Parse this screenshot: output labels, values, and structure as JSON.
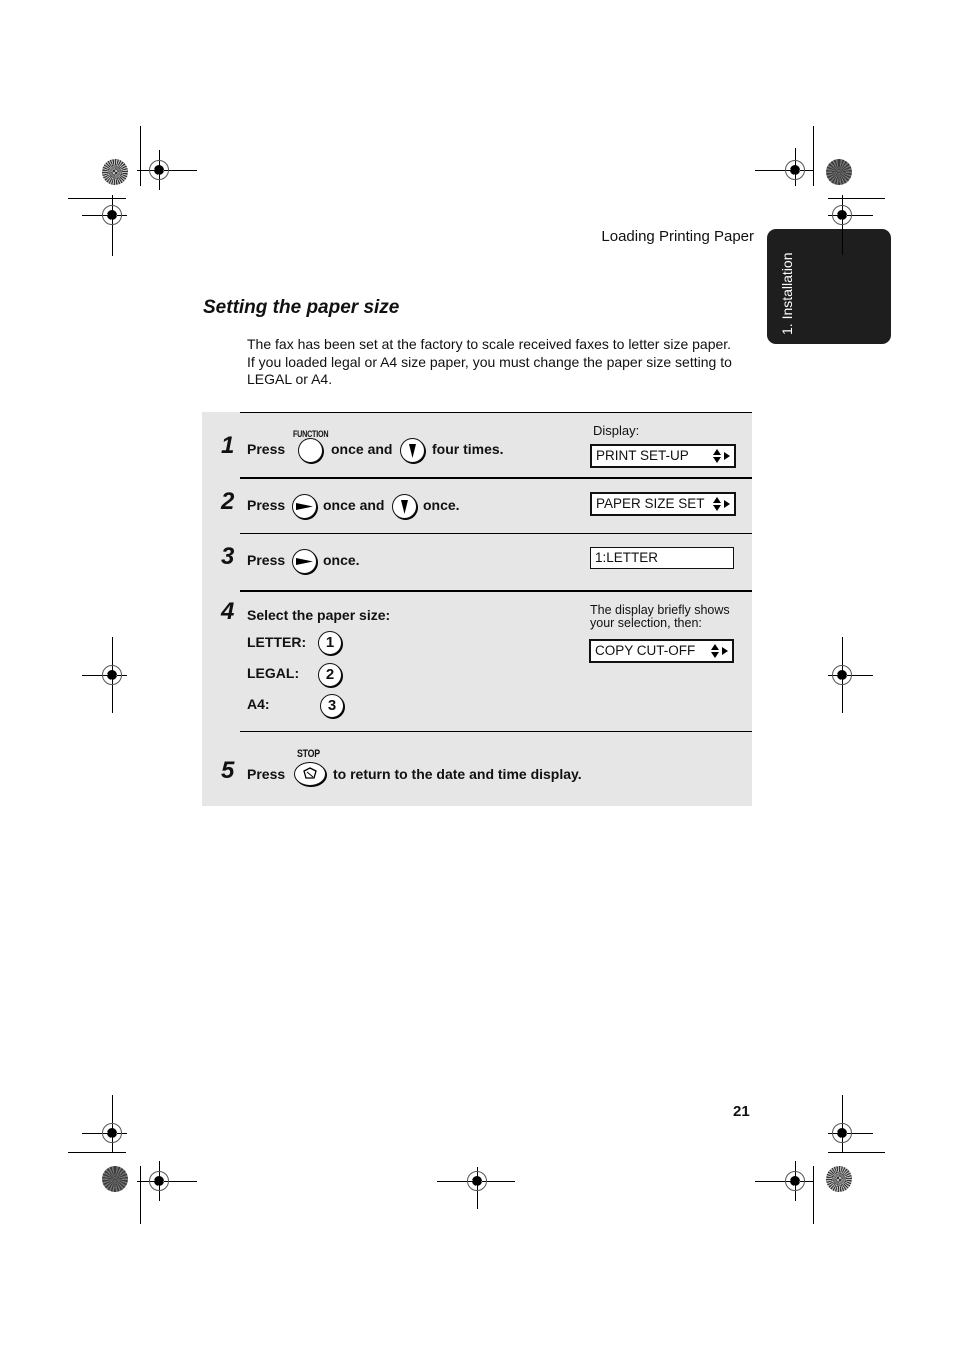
{
  "header": {
    "running_head": "Loading Printing Paper",
    "side_tab": "1. Installation"
  },
  "section": {
    "title": "Setting the paper size",
    "intro_lines": [
      "The fax has been set at the factory to scale received faxes to letter size paper.",
      "If you loaded legal or A4 size paper, you must change the paper size setting to",
      "LEGAL or A4."
    ]
  },
  "display_label": "Display:",
  "steps": [
    {
      "number": "1",
      "press": "Press",
      "key1_label": "FUNCTION",
      "key1": "function-key",
      "mid": "once and",
      "key2": "down-arrow-key",
      "end": "four times.",
      "display": "PRINT SET-UP"
    },
    {
      "number": "2",
      "press": "Press",
      "key1": "right-arrow-key",
      "mid": "once and",
      "key2": "down-arrow-key",
      "end": "once.",
      "display": "PAPER SIZE SET"
    },
    {
      "number": "3",
      "press": "Press",
      "key1": "right-arrow-key",
      "end": "once.",
      "display": "1:LETTER"
    },
    {
      "number": "4",
      "text": "Select the paper size:",
      "options": [
        {
          "label": "LETTER:",
          "key": "1"
        },
        {
          "label": "LEGAL:",
          "key": "2"
        },
        {
          "label": "A4:",
          "key": "3"
        }
      ],
      "note": [
        "The display briefly shows",
        "your selection, then:"
      ],
      "display": "COPY CUT-OFF"
    },
    {
      "number": "5",
      "press": "Press",
      "key1_label": "STOP",
      "key1": "stop-key",
      "end": "to return to the date and time display."
    }
  ],
  "page_number": "21"
}
